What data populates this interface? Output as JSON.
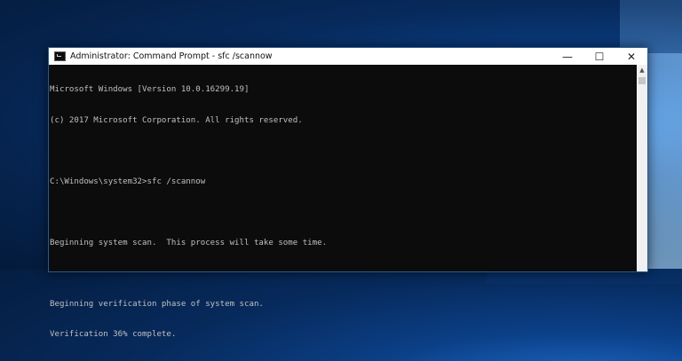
{
  "window": {
    "title": "Administrator: Command Prompt - sfc  /scannow",
    "minimize": "—",
    "maximize": "☐",
    "close": "✕"
  },
  "console": {
    "lines": [
      "Microsoft Windows [Version 10.0.16299.19]",
      "(c) 2017 Microsoft Corporation. All rights reserved.",
      "",
      "C:\\Windows\\system32>sfc /scannow",
      "",
      "Beginning system scan.  This process will take some time.",
      "",
      "Beginning verification phase of system scan.",
      "Verification 36% complete."
    ]
  },
  "colors": {
    "console_bg": "#0c0c0c",
    "console_text": "#c0c0c0",
    "desktop_blue": "#0b3f86"
  }
}
